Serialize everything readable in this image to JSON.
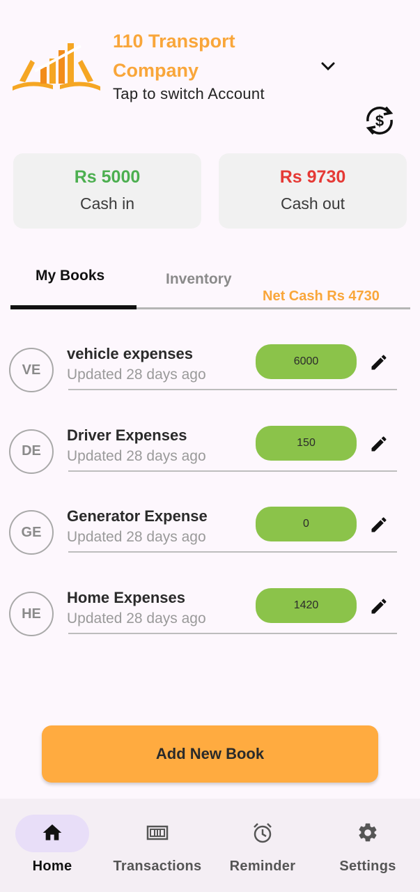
{
  "header": {
    "company_name": "110 Transport Company",
    "switch_hint": "Tap to switch Account",
    "icons": {
      "logo": "book-chart-logo",
      "dropdown": "chevron-down-icon",
      "switch": "currency-swap-icon"
    }
  },
  "summary": {
    "cash_in": {
      "amount": "Rs 5000",
      "label": "Cash in"
    },
    "cash_out": {
      "amount": "Rs 9730",
      "label": "Cash out"
    }
  },
  "tabs": {
    "active": "My Books",
    "inactive": "Inventory",
    "net_cash": "Net Cash Rs 4730"
  },
  "books": [
    {
      "initials": "VE",
      "name": "vehicle expenses",
      "updated": "Updated 28 days ago",
      "balance": "6000"
    },
    {
      "initials": "DE",
      "name": "Driver Expenses",
      "updated": "Updated 28 days ago",
      "balance": "150"
    },
    {
      "initials": "GE",
      "name": "Generator Expense",
      "updated": "Updated 28 days ago",
      "balance": "0"
    },
    {
      "initials": "HE",
      "name": "Home Expenses",
      "updated": "Updated 28 days ago",
      "balance": "1420"
    }
  ],
  "add_button": "Add New Book",
  "nav": [
    {
      "label": "Home",
      "icon": "home-icon"
    },
    {
      "label": "Transactions",
      "icon": "cash-icon"
    },
    {
      "label": "Reminder",
      "icon": "alarm-icon"
    },
    {
      "label": "Settings",
      "icon": "gear-icon"
    }
  ],
  "colors": {
    "accent": "#f9a63a",
    "cash_in": "#4caf50",
    "cash_out": "#e53935",
    "balance_pill": "#8bc34a",
    "add_button": "#ffab40",
    "nav_active_pill": "#e8def8"
  }
}
